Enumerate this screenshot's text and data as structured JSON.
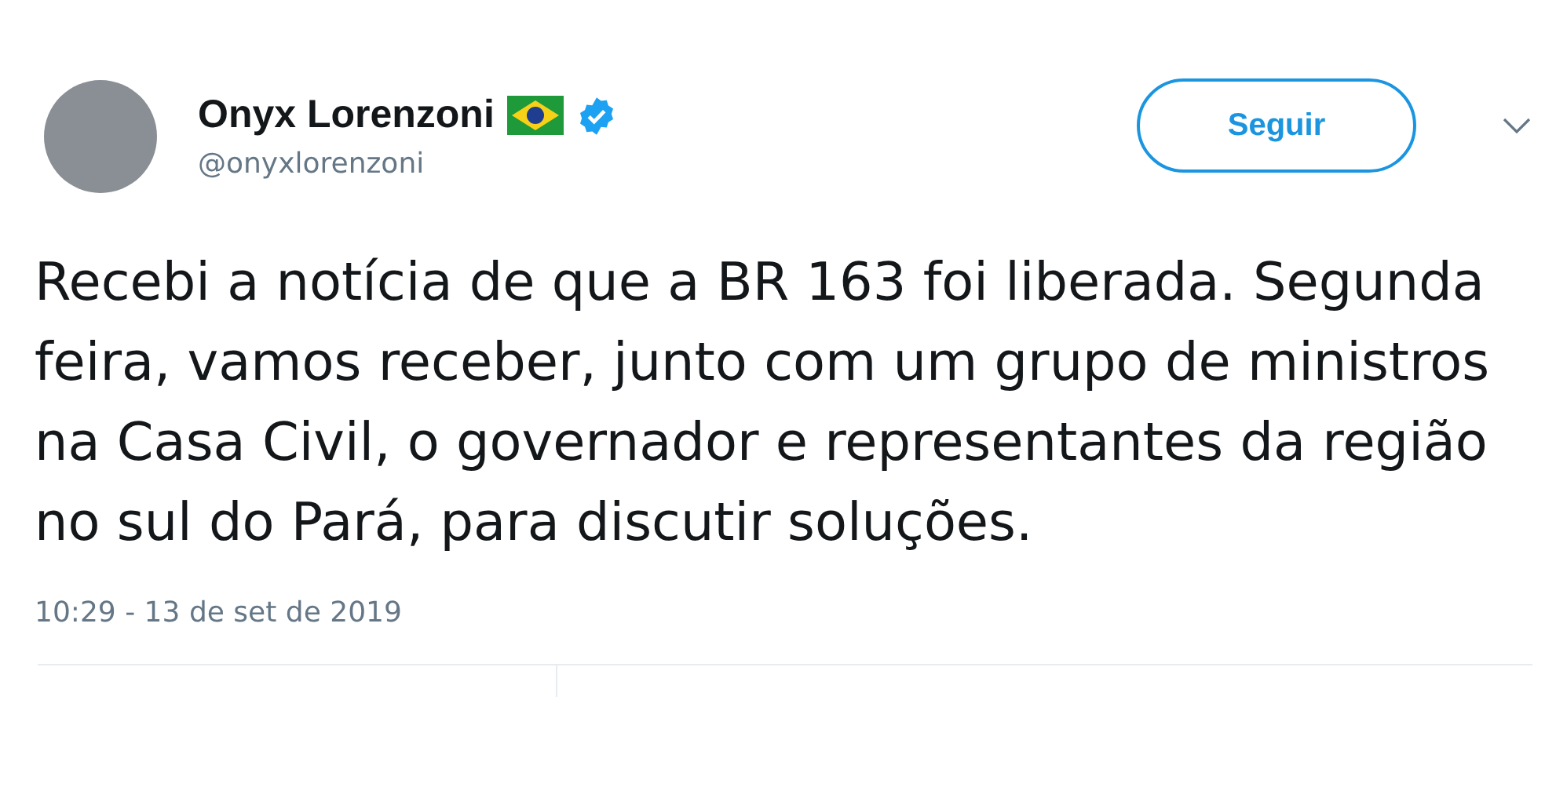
{
  "author": {
    "name": "Onyx Lorenzoni",
    "handle": "@onyxlorenzoni",
    "verified": true
  },
  "follow_button": {
    "label": "Seguir"
  },
  "tweet": {
    "text": "Recebi a notícia de que a BR 163 foi liberada. Segunda feira, vamos receber, junto com um grupo de ministros na Casa Civil, o governador e representantes da região  no sul do Pará, para discutir soluções.",
    "timestamp": "10:29 - 13 de set de 2019"
  }
}
